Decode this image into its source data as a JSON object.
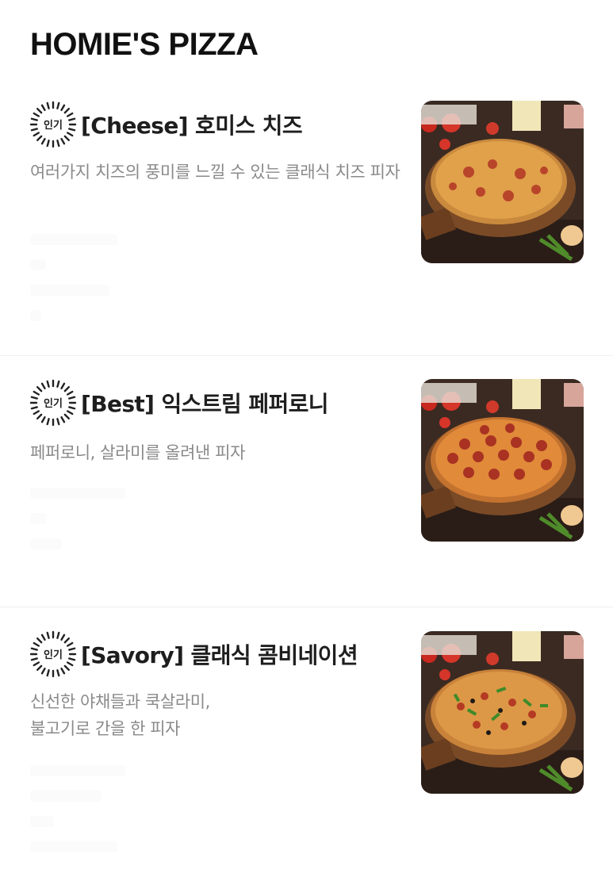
{
  "header": {
    "title": "HOMIE'S PIZZA"
  },
  "badge_label": "인기",
  "menu": [
    {
      "name": "[Cheese] 호미스 치즈",
      "description": "여러가지 치즈의 풍미를 느낄 수 있는 클래식 치즈 피자",
      "image": "cheese-pizza-image"
    },
    {
      "name": "[Best] 익스트림 페퍼로니",
      "description": "페퍼로니, 살라미를 올려낸 피자",
      "image": "pepperoni-pizza-image"
    },
    {
      "name": "[Savory] 클래식 콤비네이션",
      "description_lines": [
        "신선한 야채들과 쿡살라미,",
        "불고기로 간을 한 피자"
      ],
      "image": "combination-pizza-image"
    }
  ],
  "colors": {
    "title": "#111111",
    "name": "#1e1e1e",
    "description": "#8a8a8a",
    "divider": "#efefef"
  }
}
